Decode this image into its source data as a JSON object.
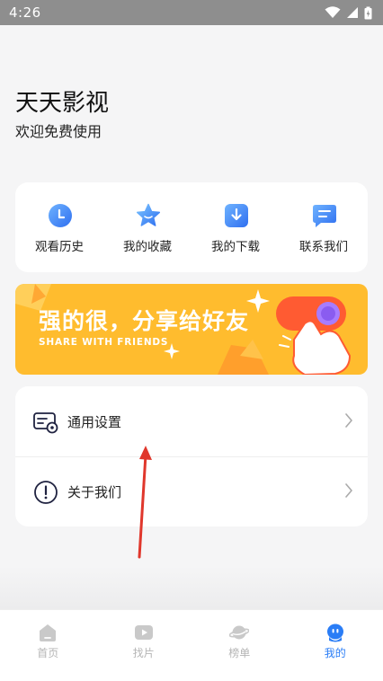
{
  "status_bar": {
    "time": "4:26"
  },
  "header": {
    "title": "天天影视",
    "subtitle": "欢迎免费使用"
  },
  "quick_actions": [
    {
      "label": "观看历史",
      "icon": "clock-icon"
    },
    {
      "label": "我的收藏",
      "icon": "star-icon"
    },
    {
      "label": "我的下载",
      "icon": "download-icon"
    },
    {
      "label": "联系我们",
      "icon": "chat-icon"
    }
  ],
  "banner": {
    "title": "强的很，分享给好友",
    "subtitle": "SHARE WITH FRIENDS"
  },
  "settings": [
    {
      "label": "通用设置",
      "icon": "settings-card-icon"
    },
    {
      "label": "关于我们",
      "icon": "info-icon"
    }
  ],
  "tabs": [
    {
      "label": "首页",
      "icon": "home-icon",
      "active": false
    },
    {
      "label": "找片",
      "icon": "play-icon",
      "active": false
    },
    {
      "label": "榜单",
      "icon": "planet-icon",
      "active": false
    },
    {
      "label": "我的",
      "icon": "profile-icon",
      "active": true
    }
  ],
  "colors": {
    "accent": "#2a7df6",
    "banner": "#ffbc2e",
    "annotation_arrow": "#e0372c"
  }
}
